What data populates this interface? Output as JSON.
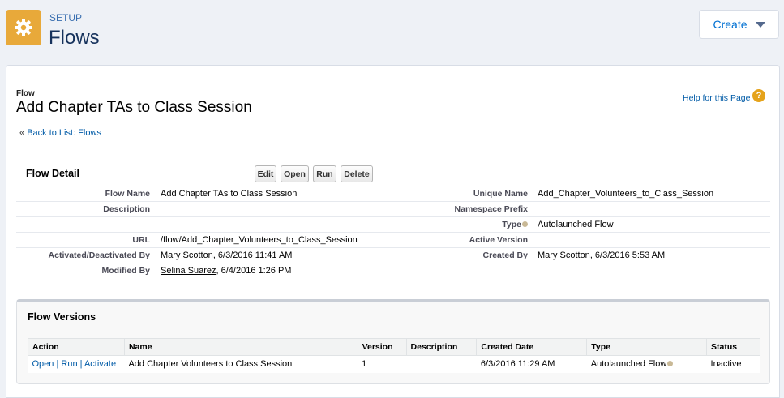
{
  "header": {
    "section_label": "SETUP",
    "page_title": "Flows",
    "create_label": "Create"
  },
  "page": {
    "type_label": "Flow",
    "title": "Add Chapter TAs to Class Session",
    "help_label": "Help for this Page",
    "help_glyph": "?",
    "back_prefix": "«",
    "back_label": "Back to List: Flows"
  },
  "detail": {
    "title": "Flow Detail",
    "buttons": {
      "edit": "Edit",
      "open": "Open",
      "run": "Run",
      "delete": "Delete"
    },
    "fields": {
      "flow_name": {
        "label": "Flow Name",
        "value": "Add Chapter TAs to Class Session"
      },
      "unique_name": {
        "label": "Unique Name",
        "value": "Add_Chapter_Volunteers_to_Class_Session"
      },
      "description": {
        "label": "Description",
        "value": ""
      },
      "namespace_prefix": {
        "label": "Namespace Prefix",
        "value": ""
      },
      "type": {
        "label": "Type",
        "value": "Autolaunched Flow"
      },
      "url": {
        "label": "URL",
        "value": "/flow/Add_Chapter_Volunteers_to_Class_Session"
      },
      "active_version": {
        "label": "Active Version",
        "value": ""
      },
      "activated_by": {
        "label": "Activated/Deactivated By",
        "user": "Mary Scotton",
        "date": ", 6/3/2016 11:41 AM"
      },
      "created_by": {
        "label": "Created By",
        "user": "Mary Scotton",
        "date": ", 6/3/2016 5:53 AM"
      },
      "modified_by": {
        "label": "Modified By",
        "user": "Selina Suarez",
        "date": ", 6/4/2016 1:26 PM"
      }
    }
  },
  "versions": {
    "title": "Flow Versions",
    "columns": {
      "action": "Action",
      "name": "Name",
      "version": "Version",
      "description": "Description",
      "created_date": "Created Date",
      "type": "Type",
      "status": "Status"
    },
    "rows": [
      {
        "action_open": "Open",
        "action_run": "Run",
        "action_activate": "Activate",
        "separator": "|",
        "name": "Add Chapter Volunteers to Class Session",
        "version": "1",
        "description": "",
        "created_date": "6/3/2016 11:29 AM",
        "type": "Autolaunched Flow",
        "status": "Inactive"
      }
    ]
  },
  "colors": {
    "accent": "#0070d2",
    "setup_icon": "#e8a93a",
    "help_icon": "#e5a31b",
    "link": "#015ba7"
  },
  "icons": {
    "setup": "gear-icon",
    "create_dropdown": "caret-down-icon",
    "help": "question-icon",
    "type_help": "info-icon"
  }
}
